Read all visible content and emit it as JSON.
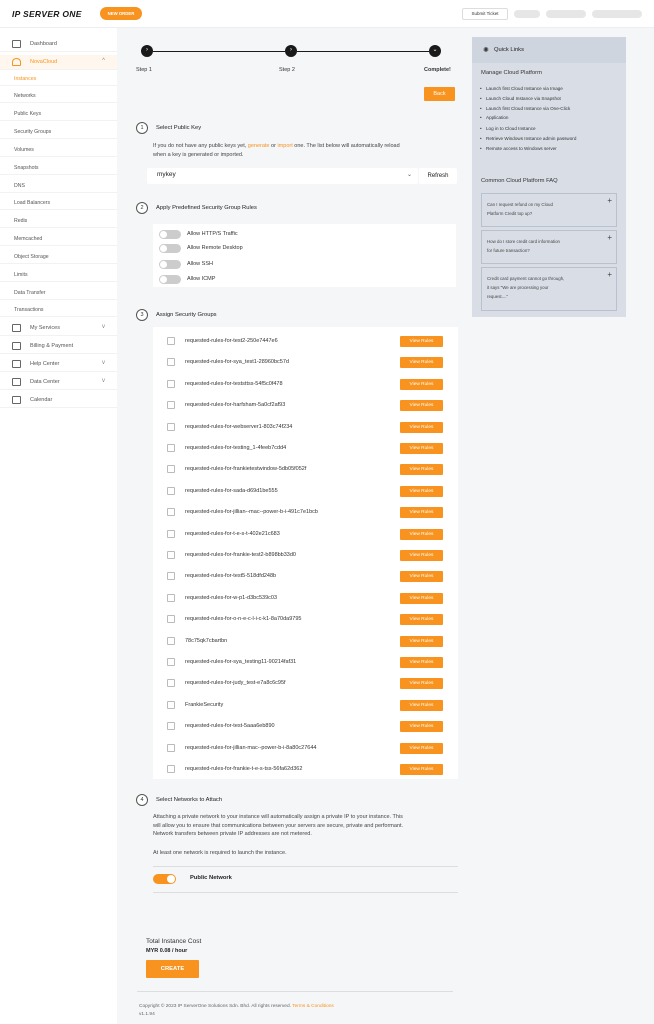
{
  "header": {
    "logo": "IP SERVER ONE",
    "new_order": "NEW ORDER",
    "submit_ticket": "Submit Ticket"
  },
  "sidebar": {
    "dashboard": "Dashboard",
    "novacloud": "NovaCloud",
    "sub": [
      "Instances",
      "Networks",
      "Public Keys",
      "Security Groups",
      "Volumes",
      "Snapshots",
      "DNS",
      "Load Balancers",
      "Redis",
      "Memcached",
      "Object Storage",
      "Limits",
      "Data Transfer",
      "Transactions"
    ],
    "my_services": "My Services",
    "billing": "Billing & Payment",
    "help": "Help Center",
    "data_center": "Data Center",
    "calendar": "Calendar"
  },
  "stepper": {
    "step1": "Step 1",
    "step2": "Step 2",
    "complete": "Complete!",
    "back": "Back"
  },
  "section1": {
    "num": "1",
    "title": "Select Public Key",
    "text_a": "If you do not have any public keys yet, ",
    "link_generate": "generate",
    "text_b": " or ",
    "link_import": "import",
    "text_c": " one. The list below will automatically reload",
    "text_d": "when a key is generated or imported.",
    "selected_key": "mykey",
    "refresh": "Refresh"
  },
  "section2": {
    "num": "2",
    "title": "Apply Predefined Security Group Rules",
    "toggles": [
      "Allow HTTP/S Traffic",
      "Allow Remote Desktop",
      "Allow SSH",
      "Allow ICMP"
    ]
  },
  "section3": {
    "num": "3",
    "title": "Assign Security Groups",
    "view_label": "View Rules",
    "rules": [
      "requested-rules-for-test2-250e7447e6",
      "requested-rules-for-sya_test1-28960bc57d",
      "requested-rules-for-teststtss-54f5c0f478",
      "requested-rules-for-harfsham-5a0cf2af93",
      "requested-rules-for-webserver1-803c74f234",
      "requested-rules-for-testing_1-4feeb7cdd4",
      "requested-rules-for-frankietestwindow-5db05f052f",
      "requested-rules-for-sada-d69d1be555",
      "requested-rules-for-jillian--mac--power-b-i-491c7e1bcb",
      "requested-rules-for-t-e-s-t-402e21c683",
      "requested-rules-for-frankie-test2-b898bb33d0",
      "requested-rules-for-test5-518dfd248b",
      "requested-rules-for-w-p1-d3bc539c03",
      "requested-rules-for-o-n-e-c-l-i-c-k1-8a70da9795",
      "78c75qk7cbartbn",
      "requested-rules-for-sya_testing11-90214faf31",
      "requested-rules-for-judy_test-e7a8c6c95f",
      "FrankieSecurity",
      "requested-rules-for-test-5aaa6eb890",
      "requested-rules-for-jillian-mac--power-b-i-8a80c27644",
      "requested-rules-for-frankie-t-e-s-tss-56fa62d362"
    ]
  },
  "section4": {
    "num": "4",
    "title": "Select Networks to Attach",
    "para1": "Attaching a private network to your instance will automatically assign a private IP to your instance. This",
    "para2": "will allow you to ensure that communications between your servers are secure, private and performant.",
    "para3": "Network transfers between private IP addresses are not metered.",
    "para4": "At least one network is required to launch the instance.",
    "network": "Public Network"
  },
  "footer": {
    "cost_label": "Total Instance Cost",
    "cost_value": "MYR 0.08 / hour",
    "create": "CREATE",
    "copyright": "Copyright © 2023 IP ServerOne Solutions Sdn. Bhd. All rights reserved.",
    "terms": "Terms & Conditions",
    "version": "v1.1.94"
  },
  "quick_links": {
    "title": "Quick Links",
    "manage_title": "Manage Cloud Platform",
    "links": [
      "Launch first Cloud Instance via Image",
      "Launch Cloud Instance via Snapshot",
      "Launch first Cloud Instance via One-Click",
      "Application",
      "Log in to Cloud Instance",
      "Retrieve Windows Instance admin password",
      "Remote access to Windows server"
    ],
    "faq_title": "Common Cloud Platform FAQ",
    "faqs": [
      [
        "Can I request refund on my Cloud",
        "Platform Credit top up?"
      ],
      [
        "How do I store credit card information",
        "for future transaction?"
      ],
      [
        "Credit card payment cannot go through,",
        "it says \"We are processing your",
        "request....\""
      ]
    ]
  },
  "colors": {
    "accent": "#f7931e",
    "panel": "#d9dee6",
    "main_bg": "#f4f6f8"
  }
}
